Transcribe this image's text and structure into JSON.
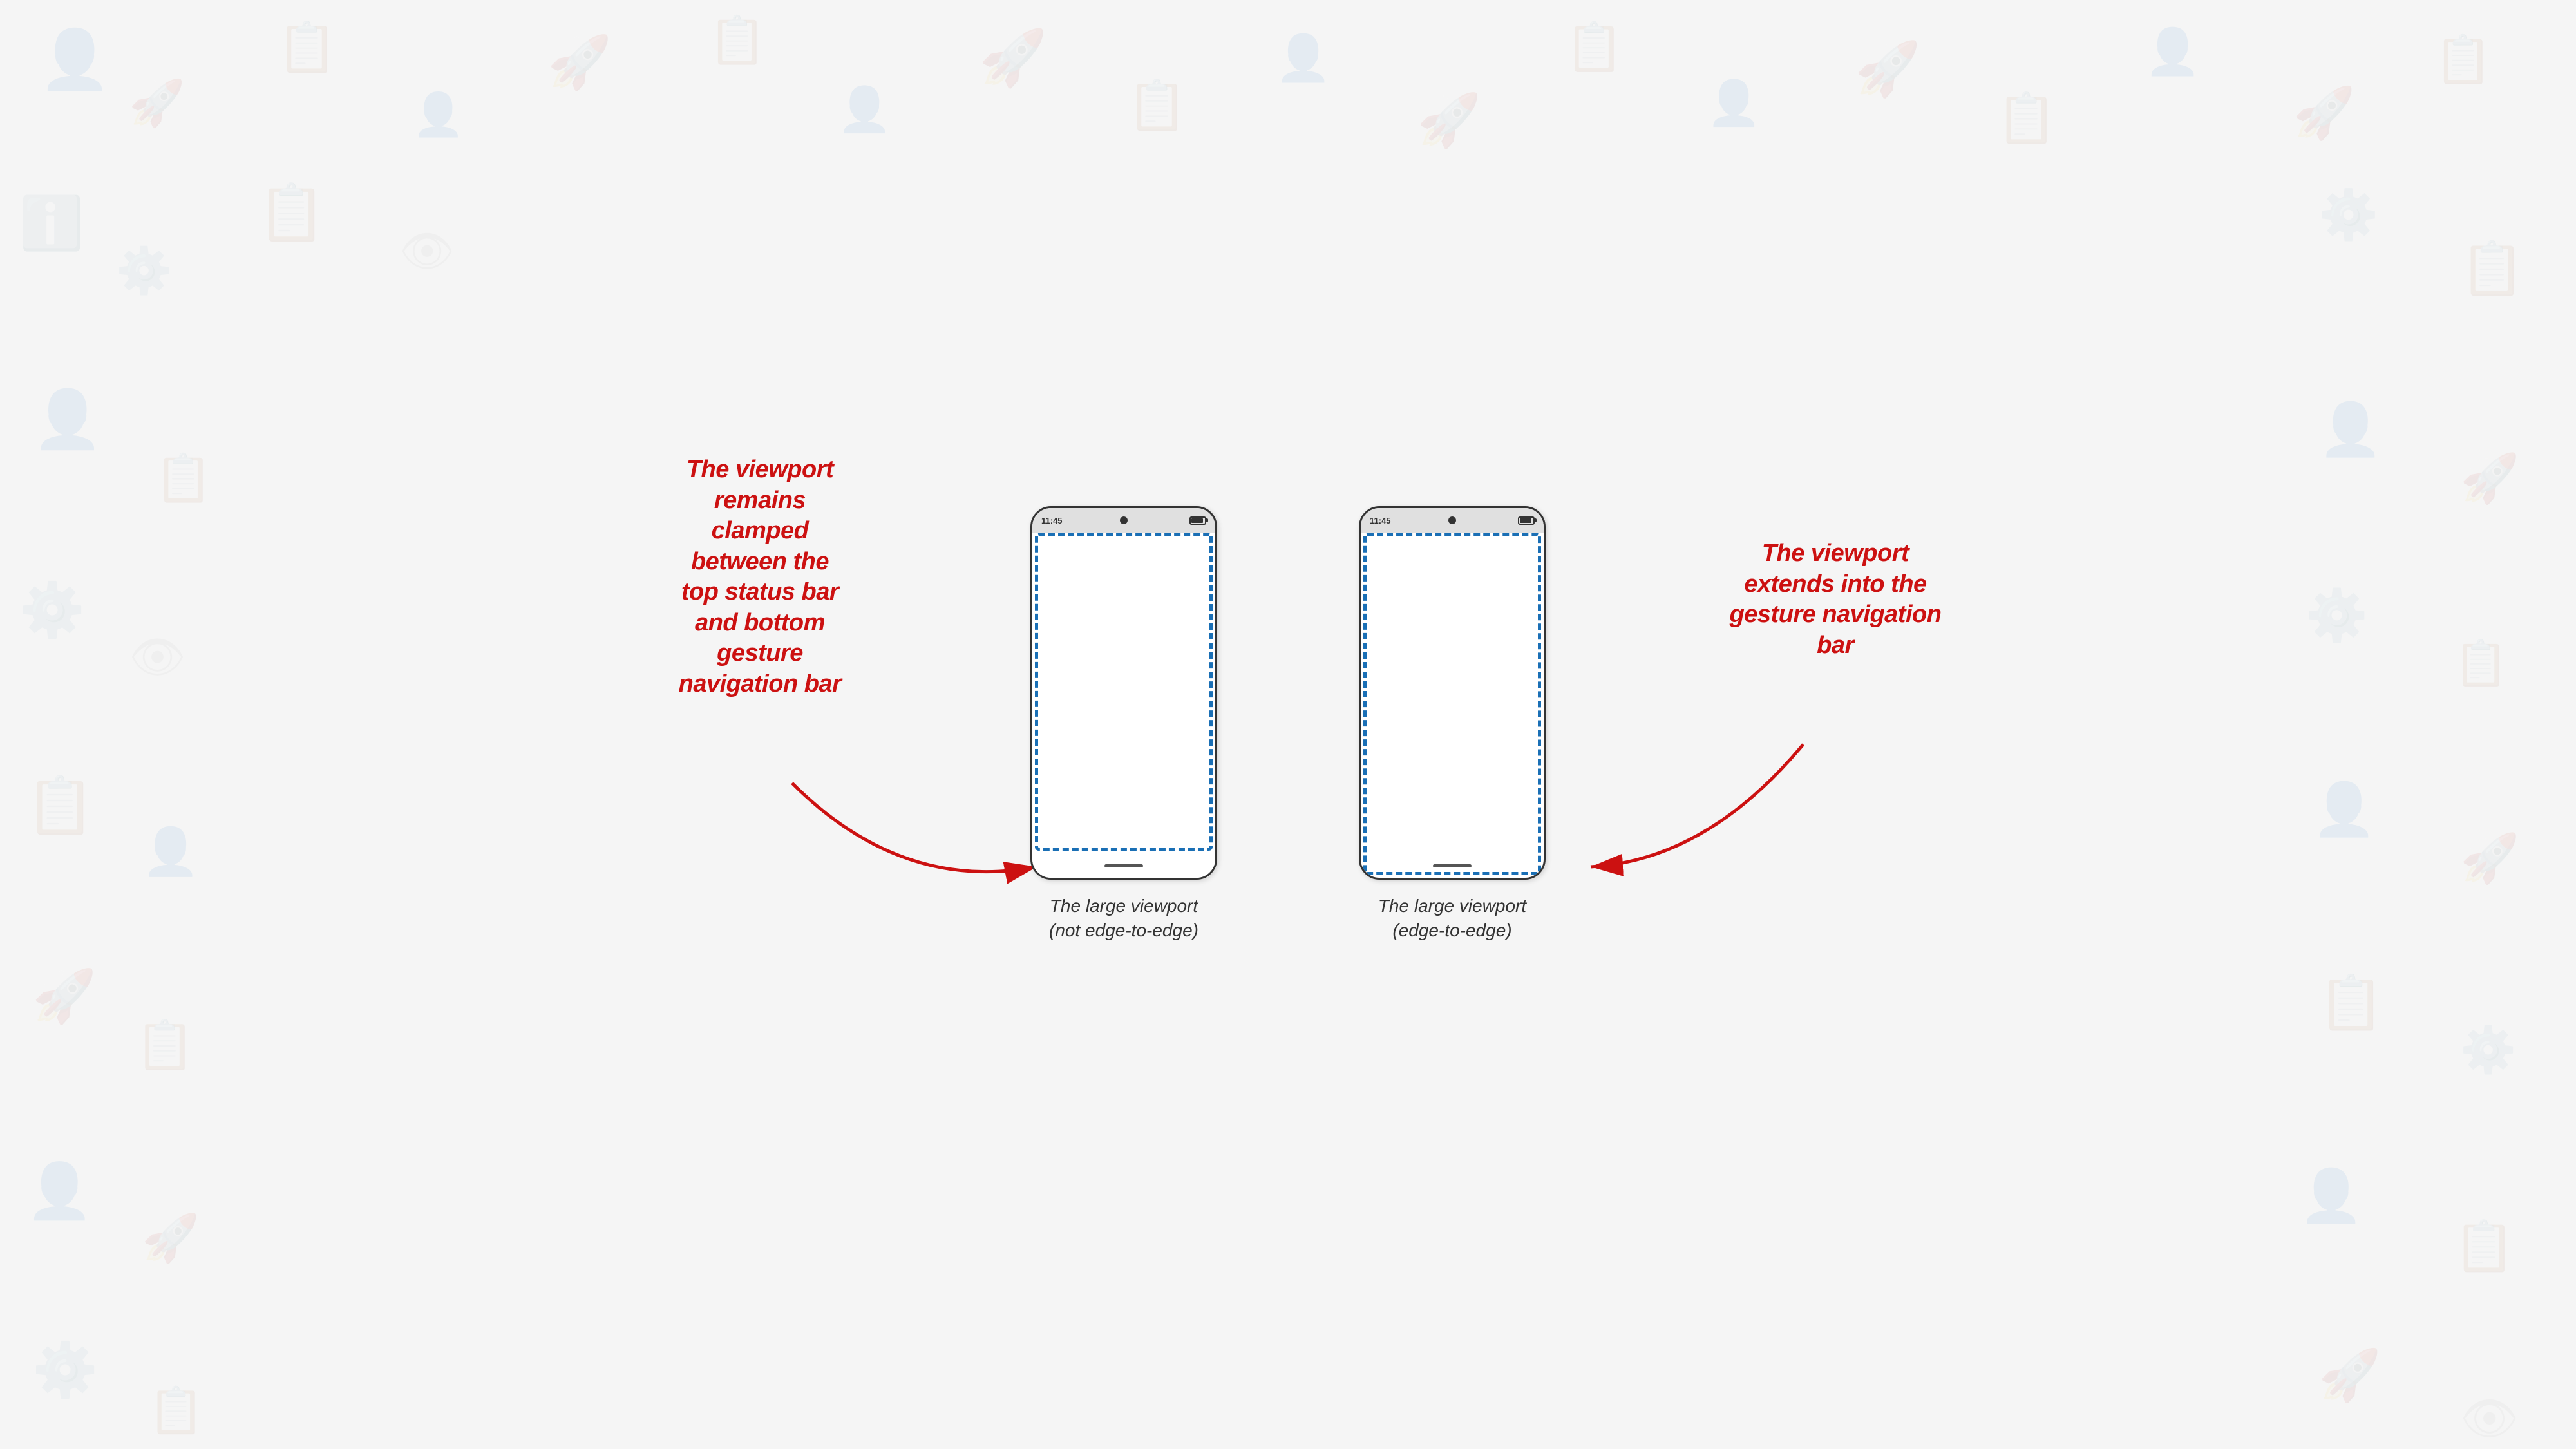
{
  "background": {
    "color": "#f0f0ee"
  },
  "phones": [
    {
      "id": "phone-left",
      "status_time": "11:45",
      "type": "not-edge-to-edge",
      "caption_line1": "The large viewport",
      "caption_line2": "(not edge-to-edge)"
    },
    {
      "id": "phone-right",
      "status_time": "11:45",
      "type": "edge-to-edge",
      "caption_line1": "The large viewport",
      "caption_line2": "(edge-to-edge)"
    }
  ],
  "annotations": {
    "left": {
      "line1": "The viewport",
      "line2": "remains",
      "line3": "clamped",
      "line4": "between the",
      "line5": "top status bar",
      "line6": "and bottom",
      "line7": "gesture",
      "line8": "navigation bar"
    },
    "right": {
      "line1": "The viewport",
      "line2": "extends into the",
      "line3": "gesture navigation",
      "line4": "bar"
    }
  }
}
